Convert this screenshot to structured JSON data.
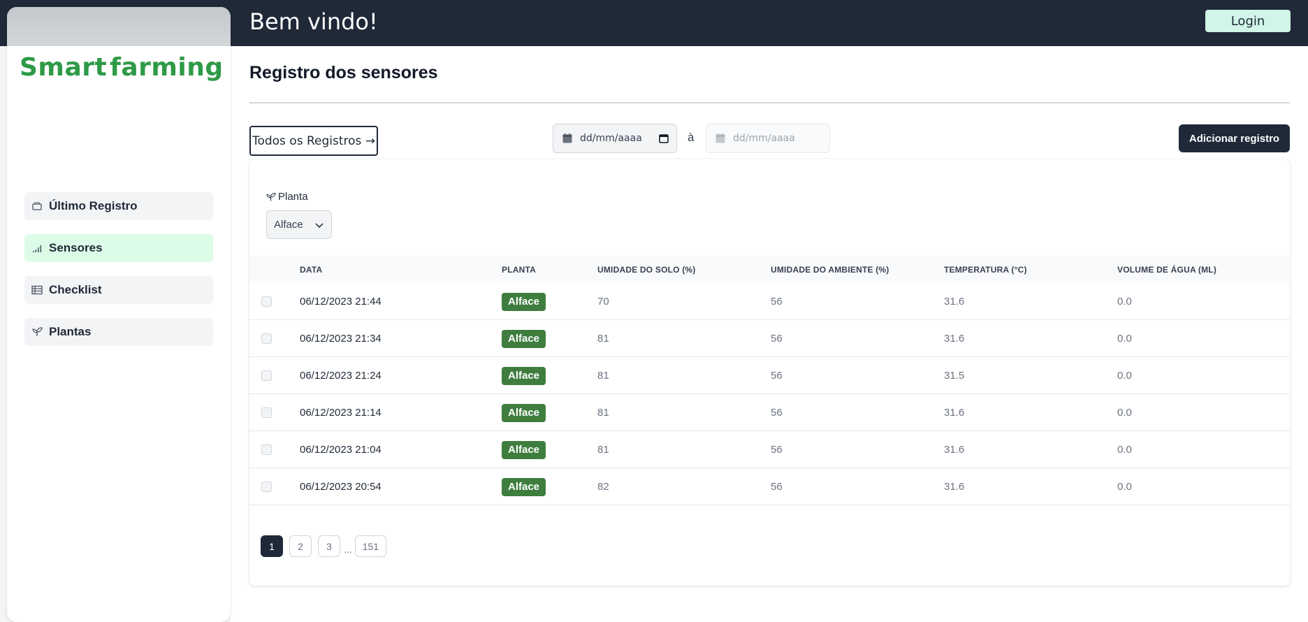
{
  "header": {
    "welcome": "Bem vindo!",
    "login_label": "Login"
  },
  "logo": {
    "part1": "Smart",
    "part2": "farming",
    "brand_color": "#2e9a47"
  },
  "sidebar": {
    "items": [
      {
        "label": "Último Registro",
        "icon": "card-icon",
        "active": false
      },
      {
        "label": "Sensores",
        "icon": "signal-bars-icon",
        "active": true
      },
      {
        "label": "Checklist",
        "icon": "table-icon",
        "active": false
      },
      {
        "label": "Plantas",
        "icon": "sprout-icon",
        "active": false
      }
    ]
  },
  "main": {
    "title": "Registro dos sensores",
    "all_records_label": "Todos os Registros →",
    "date_from_placeholder": "dd/mm/aaaa",
    "date_separator": "à",
    "date_to_placeholder": "dd/mm/aaaa",
    "add_label": "Adicionar registro"
  },
  "filter": {
    "label": "Planta",
    "selected": "Alface"
  },
  "table": {
    "columns": [
      "DATA",
      "PLANTA",
      "UMIDADE DO SOLO (%)",
      "UMIDADE DO AMBIENTE (%)",
      "TEMPERATURA (°C)",
      "VOLUME DE ÁGUA (ML)"
    ],
    "rows": [
      {
        "date": "06/12/2023 21:44",
        "plant": "Alface",
        "soil": "70",
        "ambient": "56",
        "temp": "31.6",
        "water": "0.0"
      },
      {
        "date": "06/12/2023 21:34",
        "plant": "Alface",
        "soil": "81",
        "ambient": "56",
        "temp": "31.6",
        "water": "0.0"
      },
      {
        "date": "06/12/2023 21:24",
        "plant": "Alface",
        "soil": "81",
        "ambient": "56",
        "temp": "31.5",
        "water": "0.0"
      },
      {
        "date": "06/12/2023 21:14",
        "plant": "Alface",
        "soil": "81",
        "ambient": "56",
        "temp": "31.6",
        "water": "0.0"
      },
      {
        "date": "06/12/2023 21:04",
        "plant": "Alface",
        "soil": "81",
        "ambient": "56",
        "temp": "31.6",
        "water": "0.0"
      },
      {
        "date": "06/12/2023 20:54",
        "plant": "Alface",
        "soil": "82",
        "ambient": "56",
        "temp": "31.6",
        "water": "0.0"
      }
    ]
  },
  "pagination": {
    "pages": [
      "1",
      "2",
      "3"
    ],
    "ellipsis": "...",
    "last": "151",
    "current": "1"
  }
}
